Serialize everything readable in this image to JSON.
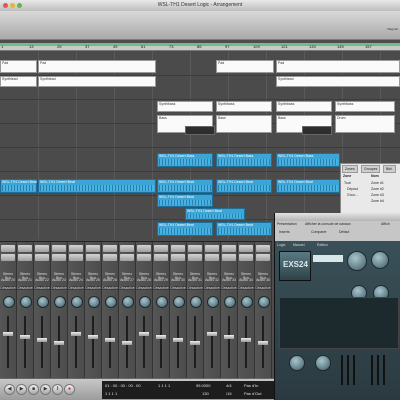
{
  "window": {
    "title": "WSL-TH1 Desert Logic - Arrangement"
  },
  "toolbar": {
    "magnifier_label": "Magnéti"
  },
  "ruler": {
    "bars": [
      "1",
      "13",
      "25",
      "37",
      "49",
      "61",
      "73",
      "85",
      "97",
      "109",
      "121",
      "133",
      "145",
      "157"
    ]
  },
  "regions": {
    "pad": "Pad",
    "synthlead": "Synthlead",
    "synthbass": "Synthbass",
    "bass": "Bass",
    "drum": "Drum",
    "desert_bass": "WSL-TH1 Desert Bass",
    "desert_beat": "WSL-TH1 Desert Beat"
  },
  "mixer": {
    "strips": [
      {
        "name": "Stereo Bus",
        "ch": "Audio 20"
      },
      {
        "name": "Stereo Bus",
        "ch": "Audio 21"
      },
      {
        "name": "Stereo Bus",
        "ch": "Audio 22"
      },
      {
        "name": "Stereo Bus",
        "ch": "Audio 23"
      },
      {
        "name": "Stereo Bus",
        "ch": "Audio 24"
      },
      {
        "name": "Stereo Bus",
        "ch": "Audio 25"
      },
      {
        "name": "Stereo Bus",
        "ch": "Audio 26"
      },
      {
        "name": "Stereo Bus",
        "ch": "Audio 27"
      },
      {
        "name": "Stereo Bus",
        "ch": "Audio 28"
      },
      {
        "name": "Stereo Bus",
        "ch": "Audio 29"
      },
      {
        "name": "Stereo Bus",
        "ch": "Audio 30"
      },
      {
        "name": "Stereo Bus",
        "ch": "Audio 31"
      },
      {
        "name": "Stereo Bus",
        "ch": "Audio 32"
      },
      {
        "name": "Stereo Bus",
        "ch": "Audio 33"
      },
      {
        "name": "Stereo Bus",
        "ch": "Audio 34"
      },
      {
        "name": "Stereo Bus",
        "ch": "Audio 35"
      }
    ],
    "bus_labels": [
      "Bs 17-18",
      "Bs 17-18",
      "Bs 17-18"
    ],
    "automation": "Désactivé"
  },
  "library": {
    "tabs": [
      "Zones",
      "Groupes",
      "Bibl."
    ],
    "header": [
      "Zone",
      "Nom"
    ],
    "items": [
      "Tout",
      "Dépoul",
      "Grou..."
    ],
    "zones": [
      "Zone #1",
      "Zone #2",
      "Zone #3",
      "Zone #4"
    ]
  },
  "plugin": {
    "tabs": [
      "Présentation",
      "Afficher la console de canaux",
      "Affich"
    ],
    "sub": [
      "Inserts",
      "Comparer",
      "Défaut"
    ],
    "brand": "EXS24",
    "labels": [
      "Logic",
      "Manuel",
      "Édition"
    ]
  },
  "transport": {
    "position": "01 : 00 : 00 : 00 . 00",
    "bars": "1  1  1  1",
    "bars2": "1  1  1  1",
    "tempo": "95.0000",
    "tempo2": "130",
    "sig": "4/4",
    "sig2": "/16",
    "pos_in": "Pas d'In",
    "pos_out": "Pas d'Out"
  }
}
